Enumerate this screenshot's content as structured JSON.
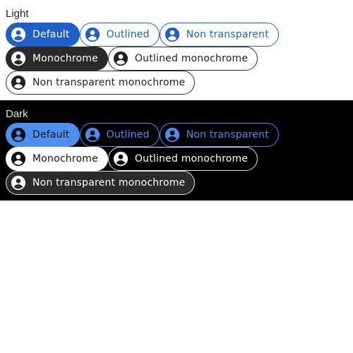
{
  "light": {
    "title": "Light",
    "chips": {
      "default": "Default",
      "outlined": "Outlined",
      "non_transparent": "Non transparent",
      "monochrome": "Monochrome",
      "outlined_monochrome": "Outlined monochrome",
      "non_transparent_monochrome": "Non transparent monochrome"
    }
  },
  "dark": {
    "title": "Dark",
    "chips": {
      "default": "Default",
      "outlined": "Outlined",
      "non_transparent": "Non transparent",
      "monochrome": "Monochrome",
      "outlined_monochrome": "Outlined monochrome",
      "non_transparent_monochrome": "Non transparent monochrome"
    }
  },
  "icons": {
    "chip_icon": "account-circle-icon"
  },
  "colors": {
    "light_accent": "#1f5fc7",
    "dark_accent": "#4d8ef0",
    "light_mono": "#2a2a2a",
    "dark_background": "#000000"
  }
}
